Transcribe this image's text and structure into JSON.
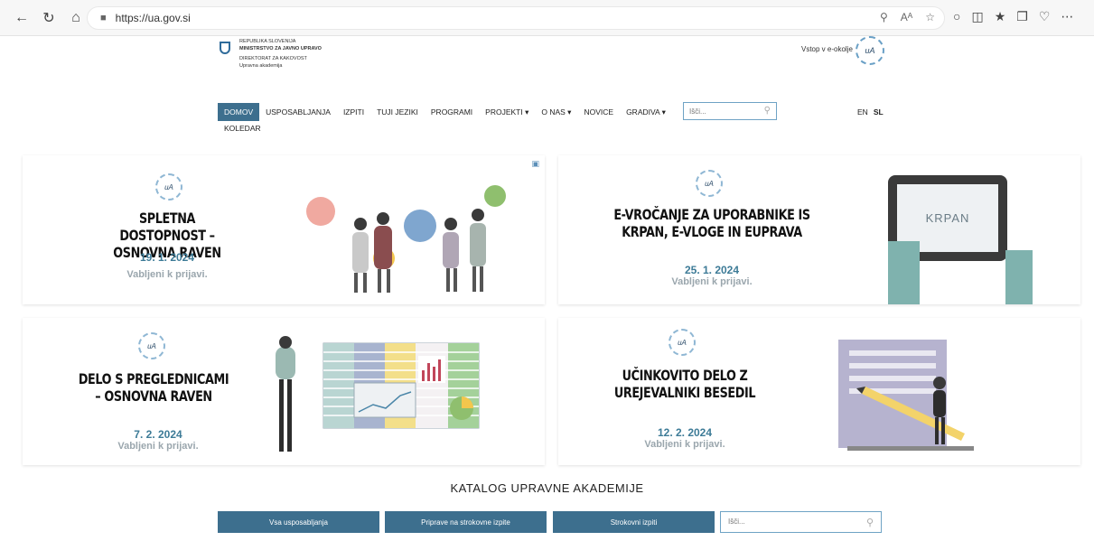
{
  "browser": {
    "url": "https://ua.gov.si",
    "read_aloud": "Aᴬ",
    "nav_icons": [
      "back-icon",
      "refresh-icon",
      "home-icon"
    ]
  },
  "header": {
    "org_line1": "REPUBLIKA SLOVENIJA",
    "org_line2": "MINISTRSTVO ZA JAVNO UPRAVO",
    "org_line3": "DIREKTORAT ZA KAKOVOST",
    "org_line4": "Upravna akademija",
    "eokolje_label": "Vstop v e-okolje",
    "badge_text": "uA"
  },
  "nav": {
    "items": [
      {
        "label": "DOMOV",
        "active": true
      },
      {
        "label": "USPOSABLJANJA"
      },
      {
        "label": "IZPITI"
      },
      {
        "label": "TUJI JEZIKI"
      },
      {
        "label": "PROGRAMI"
      },
      {
        "label": "PROJEKTI ▾"
      },
      {
        "label": "O NAS ▾"
      },
      {
        "label": "NOVICE"
      },
      {
        "label": "GRADIVA ▾"
      }
    ],
    "second_row": "KOLEDAR",
    "search_placeholder": "Išči...",
    "lang_en": "EN",
    "lang_sl": "SL"
  },
  "cards": [
    {
      "title": "SPLETNA DOSTOPNOST – OSNOVNA RAVEN",
      "date": "19. 1. 2024",
      "sub": "Vabljeni k prijavi."
    },
    {
      "title": "E-VROČANJE ZA UPORABNIKE IS KRPAN, E-VLOGE IN EUPRAVA",
      "date": "25. 1. 2024",
      "sub": "Vabljeni k prijavi.",
      "tablet_text": "KRPAN"
    },
    {
      "title": "DELO S PREGLEDNICAMI – OSNOVNA RAVEN",
      "date": "7. 2. 2024",
      "sub": "Vabljeni k prijavi."
    },
    {
      "title": "UČINKOVITO DELO Z UREJEVALNIKI BESEDIL",
      "date": "12. 2. 2024",
      "sub": "Vabljeni k prijavi."
    }
  ],
  "catalog": {
    "title": "KATALOG UPRAVNE AKADEMIJE",
    "btn1": "Vsa usposabljanja",
    "btn2": "Priprave na strokovne izpite",
    "btn3": "Strokovni izpiti",
    "search_placeholder": "Išči..."
  },
  "colors": {
    "accent": "#3d6f8e",
    "date": "#3d7b97",
    "subtle": "#9aa6ad"
  }
}
